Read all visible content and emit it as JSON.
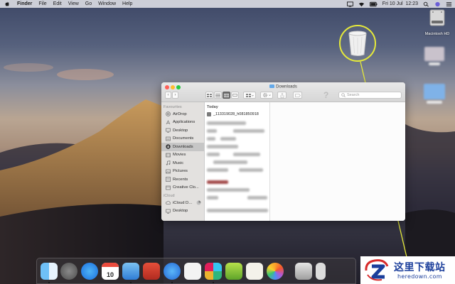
{
  "menubar": {
    "app_name": "Finder",
    "items": [
      "File",
      "Edit",
      "View",
      "Go",
      "Window",
      "Help"
    ],
    "clock": "Fri 10 Jul  12:23"
  },
  "desktop": {
    "drive_label": "Macintosh HD"
  },
  "finder": {
    "title": "Downloads",
    "search_placeholder": "Search",
    "help_glyph": "?",
    "sidebar": {
      "favourites_heading": "Favourites",
      "favourites": [
        {
          "label": "AirDrop",
          "icon": "airdrop-icon"
        },
        {
          "label": "Applications",
          "icon": "applications-icon"
        },
        {
          "label": "Desktop",
          "icon": "desktop-folder-icon"
        },
        {
          "label": "Documents",
          "icon": "documents-icon"
        },
        {
          "label": "Downloads",
          "icon": "downloads-icon",
          "selected": true
        },
        {
          "label": "Movies",
          "icon": "movies-icon"
        },
        {
          "label": "Music",
          "icon": "music-icon"
        },
        {
          "label": "Pictures",
          "icon": "pictures-icon"
        },
        {
          "label": "Recents",
          "icon": "recents-icon"
        },
        {
          "label": "Creative Clo...",
          "icon": "creative-cloud-icon"
        }
      ],
      "icloud_heading": "iCloud",
      "icloud": [
        {
          "label": "iCloud D...",
          "icon": "icloud-drive-icon"
        },
        {
          "label": "Desktop",
          "icon": "desktop-folder-icon"
        }
      ]
    },
    "column": {
      "heading": "Today",
      "first_file": "_113319028_h081850918"
    }
  },
  "dock": {
    "calendar_day": "10",
    "apps": [
      "finder-icon",
      "launchpad-icon",
      "app-store-icon",
      "calendar-icon",
      "mail-icon",
      "photo-booth-icon",
      "safari-icon",
      "dictionary-icon",
      "slack-icon",
      "keka-icon",
      "textedit-icon",
      "photos-icon",
      "preview-icon"
    ]
  },
  "watermark": {
    "cn_text": "这里下载站",
    "en_text": "heredown.com"
  },
  "colors": {
    "highlight_ring": "#e6ea3a",
    "selection": "#c6c6c6",
    "watermark_blue": "#1b3e9b"
  }
}
